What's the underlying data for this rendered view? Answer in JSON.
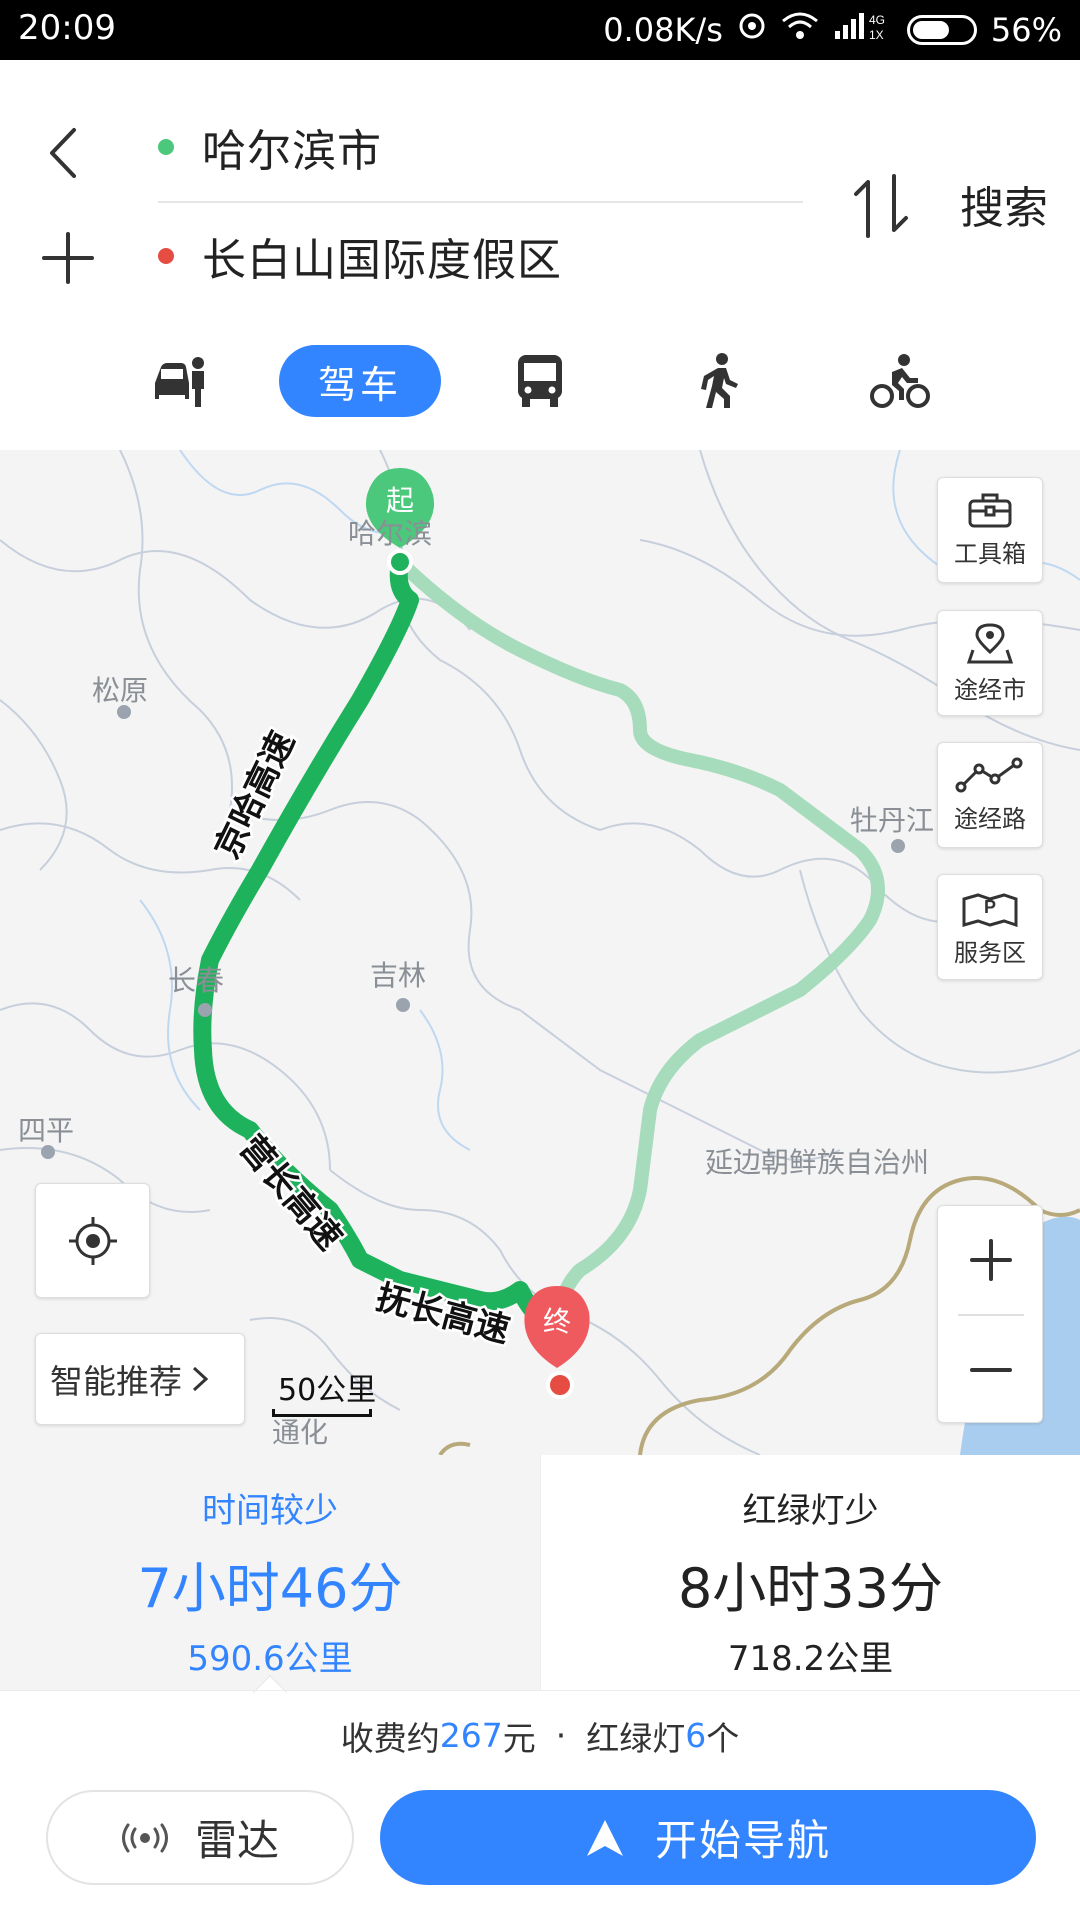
{
  "status_bar": {
    "time": "20:09",
    "net_speed": "0.08K/s",
    "network": "4G",
    "network_sub": "1X",
    "battery": "56%"
  },
  "header": {
    "origin": "哈尔滨市",
    "destination": "长白山国际度假区",
    "search_label": "搜索",
    "origin_dot_color": "#4cc87c",
    "destination_dot_color": "#e54d42"
  },
  "modes": {
    "driving_label": "驾车",
    "active": "驾车",
    "accent": "#3385ff"
  },
  "map": {
    "start_marker": "起",
    "end_marker": "终",
    "city_labels": [
      "哈尔滨",
      "松原",
      "牡丹江",
      "长春",
      "吉林",
      "四平",
      "延边朝鲜族自治州",
      "通化"
    ],
    "road_labels": [
      "京哈高速",
      "营长高速",
      "抚长高速"
    ],
    "tools": {
      "toolbox": "工具箱",
      "via_city": "途经市",
      "via_road": "途经路",
      "service_area": "服务区"
    },
    "smart_recommend": "智能推荐",
    "scale": "50公里",
    "route_primary_color": "#1fb25c",
    "route_alt_color": "#a6dcbc"
  },
  "routes": [
    {
      "tag": "时间较少",
      "duration": "7小时46分",
      "distance": "590.6公里"
    },
    {
      "tag": "红绿灯少",
      "duration": "8小时33分",
      "distance": "718.2公里"
    }
  ],
  "summary": {
    "toll_prefix": "收费约",
    "toll_value": "267",
    "toll_unit": "元",
    "separator": "·",
    "lights_prefix": "红绿灯",
    "lights_value": "6",
    "lights_unit": "个"
  },
  "actions": {
    "radar": "雷达",
    "start_navigation": "开始导航"
  }
}
